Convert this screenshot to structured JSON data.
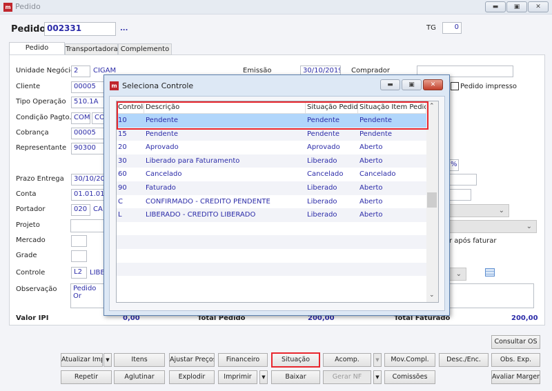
{
  "window": {
    "title": "Pedido",
    "controls": [
      "minimize",
      "restore",
      "close"
    ]
  },
  "header": {
    "pedido_label": "Pedido",
    "pedido_value": "002331",
    "lookup": "...",
    "tg_label": "TG",
    "tg_value": "0"
  },
  "tabs": [
    {
      "label": "Pedido",
      "active": true
    },
    {
      "label": "Transportadora"
    },
    {
      "label": "Complemento"
    }
  ],
  "form": {
    "unidade_label": "Unidade Negócio",
    "unidade_code": "2",
    "unidade_name": "CIGAM",
    "emissao_label": "Emissão",
    "emissao_value": "30/10/2019",
    "comprador_label": "Comprador",
    "comprador_value": "",
    "cliente_label": "Cliente",
    "cliente_value": "00005",
    "pedido_impresso_label": "Pedido impresso",
    "pedido_impresso_checked": false,
    "tipo_label": "Tipo Operação",
    "tipo_value": "510.1A",
    "condicao_label": "Condição Pagto.",
    "condicao_code": "COM",
    "condicao_code2": "CO",
    "cobranca_label": "Cobrança",
    "cobranca_value": "00005",
    "representante_label": "Representante",
    "representante_value": "90300",
    "prazo_label": "Prazo Entrega",
    "prazo_value": "30/10/20",
    "conta_label": "Conta",
    "conta_value": "01.01.01",
    "portador_label": "Portador",
    "portador_code": "020",
    "portador_name": "CA",
    "projeto_label": "Projeto",
    "mercado_label": "Mercado",
    "grade_label": "Grade",
    "controle_label": "Controle",
    "controle_code": "L2",
    "controle_name": "LIBE",
    "observacao_label": "Observação",
    "observacao_value": "Pedido Or",
    "percent": "%",
    "apos_faturar": "r após faturar"
  },
  "totals": {
    "valor_ipi_label": "Valor IPI",
    "valor_ipi": "0,00",
    "total_pedido_label": "Total Pedido",
    "total_pedido": "200,00",
    "total_faturado_label": "Total Faturado",
    "total_faturado": "200,00"
  },
  "dialog": {
    "title": "Seleciona Controle",
    "columns": [
      "Controle",
      "Descrição",
      "Situação Pedido",
      "Situação Item Pedido"
    ],
    "rows": [
      [
        "10",
        "Pendente",
        "Pendente",
        "Pendente"
      ],
      [
        "15",
        "Pendente",
        "Pendente",
        "Pendente"
      ],
      [
        "20",
        "Aprovado",
        "Aprovado",
        "Aberto"
      ],
      [
        "30",
        "Liberado para Faturamento",
        "Liberado",
        "Aberto"
      ],
      [
        "60",
        "Cancelado",
        "Cancelado",
        "Cancelado"
      ],
      [
        "90",
        "Faturado",
        "Liberado",
        "Aberto"
      ],
      [
        "C",
        "CONFIRMADO - CREDITO PENDENTE",
        "Liberado",
        "Aberto"
      ],
      [
        "L",
        "LIBERADO - CREDITO LIBERADO",
        "Liberado",
        "Aberto"
      ]
    ],
    "selected_row": 0,
    "highlight_color": "#e8262d"
  },
  "buttons": {
    "consultar_os": "Consultar OS",
    "row1": [
      "Atualizar Imp",
      "Itens",
      "Ajustar Preços",
      "Financeiro",
      "Situação",
      "Acomp.",
      "Mov.Compl.",
      "Desc./Enc.",
      "Obs. Exp."
    ],
    "row2": [
      "Repetir",
      "Aglutinar",
      "Explodir",
      "Imprimir",
      "Baixar",
      "Gerar NF",
      "Comissões",
      "Avaliar Margem"
    ]
  }
}
